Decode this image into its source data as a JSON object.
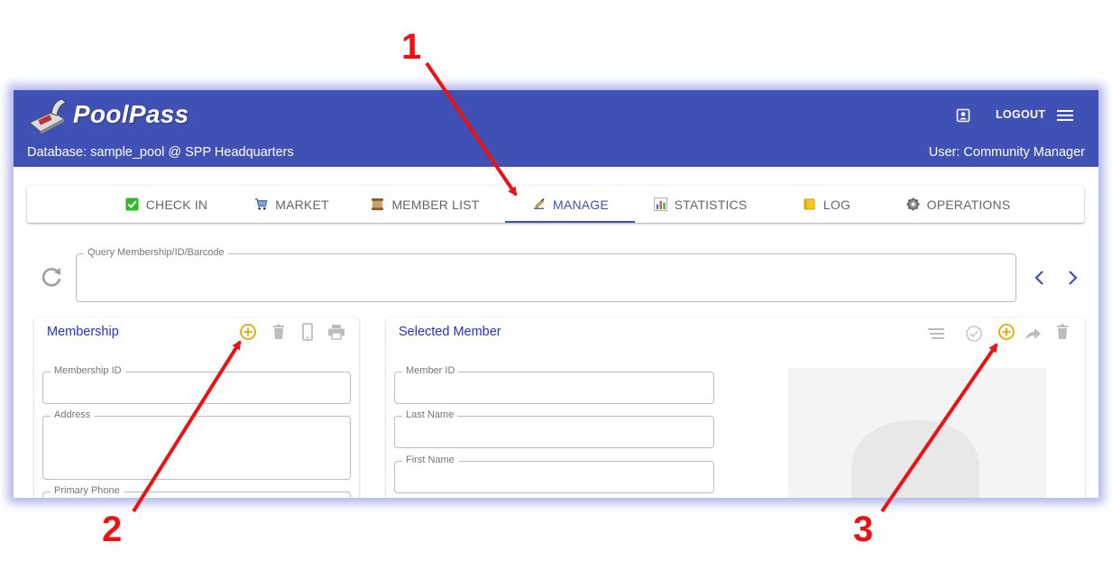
{
  "header": {
    "app_title": "PoolPass",
    "database_line": "Database: sample_pool @ SPP Headquarters",
    "user_line": "User: Community Manager",
    "logout_label": "LOGOUT",
    "brand_color": "#3f51b5"
  },
  "tabs": [
    {
      "label": "CHECK IN",
      "icon": "check-box-emoji"
    },
    {
      "label": "MARKET",
      "icon": "cart-emoji"
    },
    {
      "label": "MEMBER LIST",
      "icon": "scroll-emoji"
    },
    {
      "label": "MANAGE",
      "icon": "writing-hand-emoji",
      "active": true
    },
    {
      "label": "STATISTICS",
      "icon": "bar-chart-emoji"
    },
    {
      "label": "LOG",
      "icon": "ledger-emoji"
    },
    {
      "label": "OPERATIONS",
      "icon": "gear-emoji"
    }
  ],
  "query": {
    "label": "Query Membership/ID/Barcode",
    "value": ""
  },
  "membership_card": {
    "title": "Membership",
    "fields": [
      "Membership ID",
      "Address",
      "Primary Phone"
    ],
    "tools": [
      "add-circle-icon",
      "trash-icon",
      "phone-icon",
      "print-icon"
    ]
  },
  "member_card": {
    "title": "Selected Member",
    "fields": [
      "Member ID",
      "Last Name",
      "First Name"
    ],
    "tools": [
      "list-icon",
      "check-circle-icon",
      "add-circle-icon",
      "share-arrow-icon",
      "trash-icon"
    ]
  },
  "annotations": [
    "1",
    "2",
    "3"
  ],
  "colors": {
    "accent": "#3f51b5",
    "card_title": "#2233cc",
    "add_highlight": "#e6a800",
    "annotation": "#ee1111"
  }
}
